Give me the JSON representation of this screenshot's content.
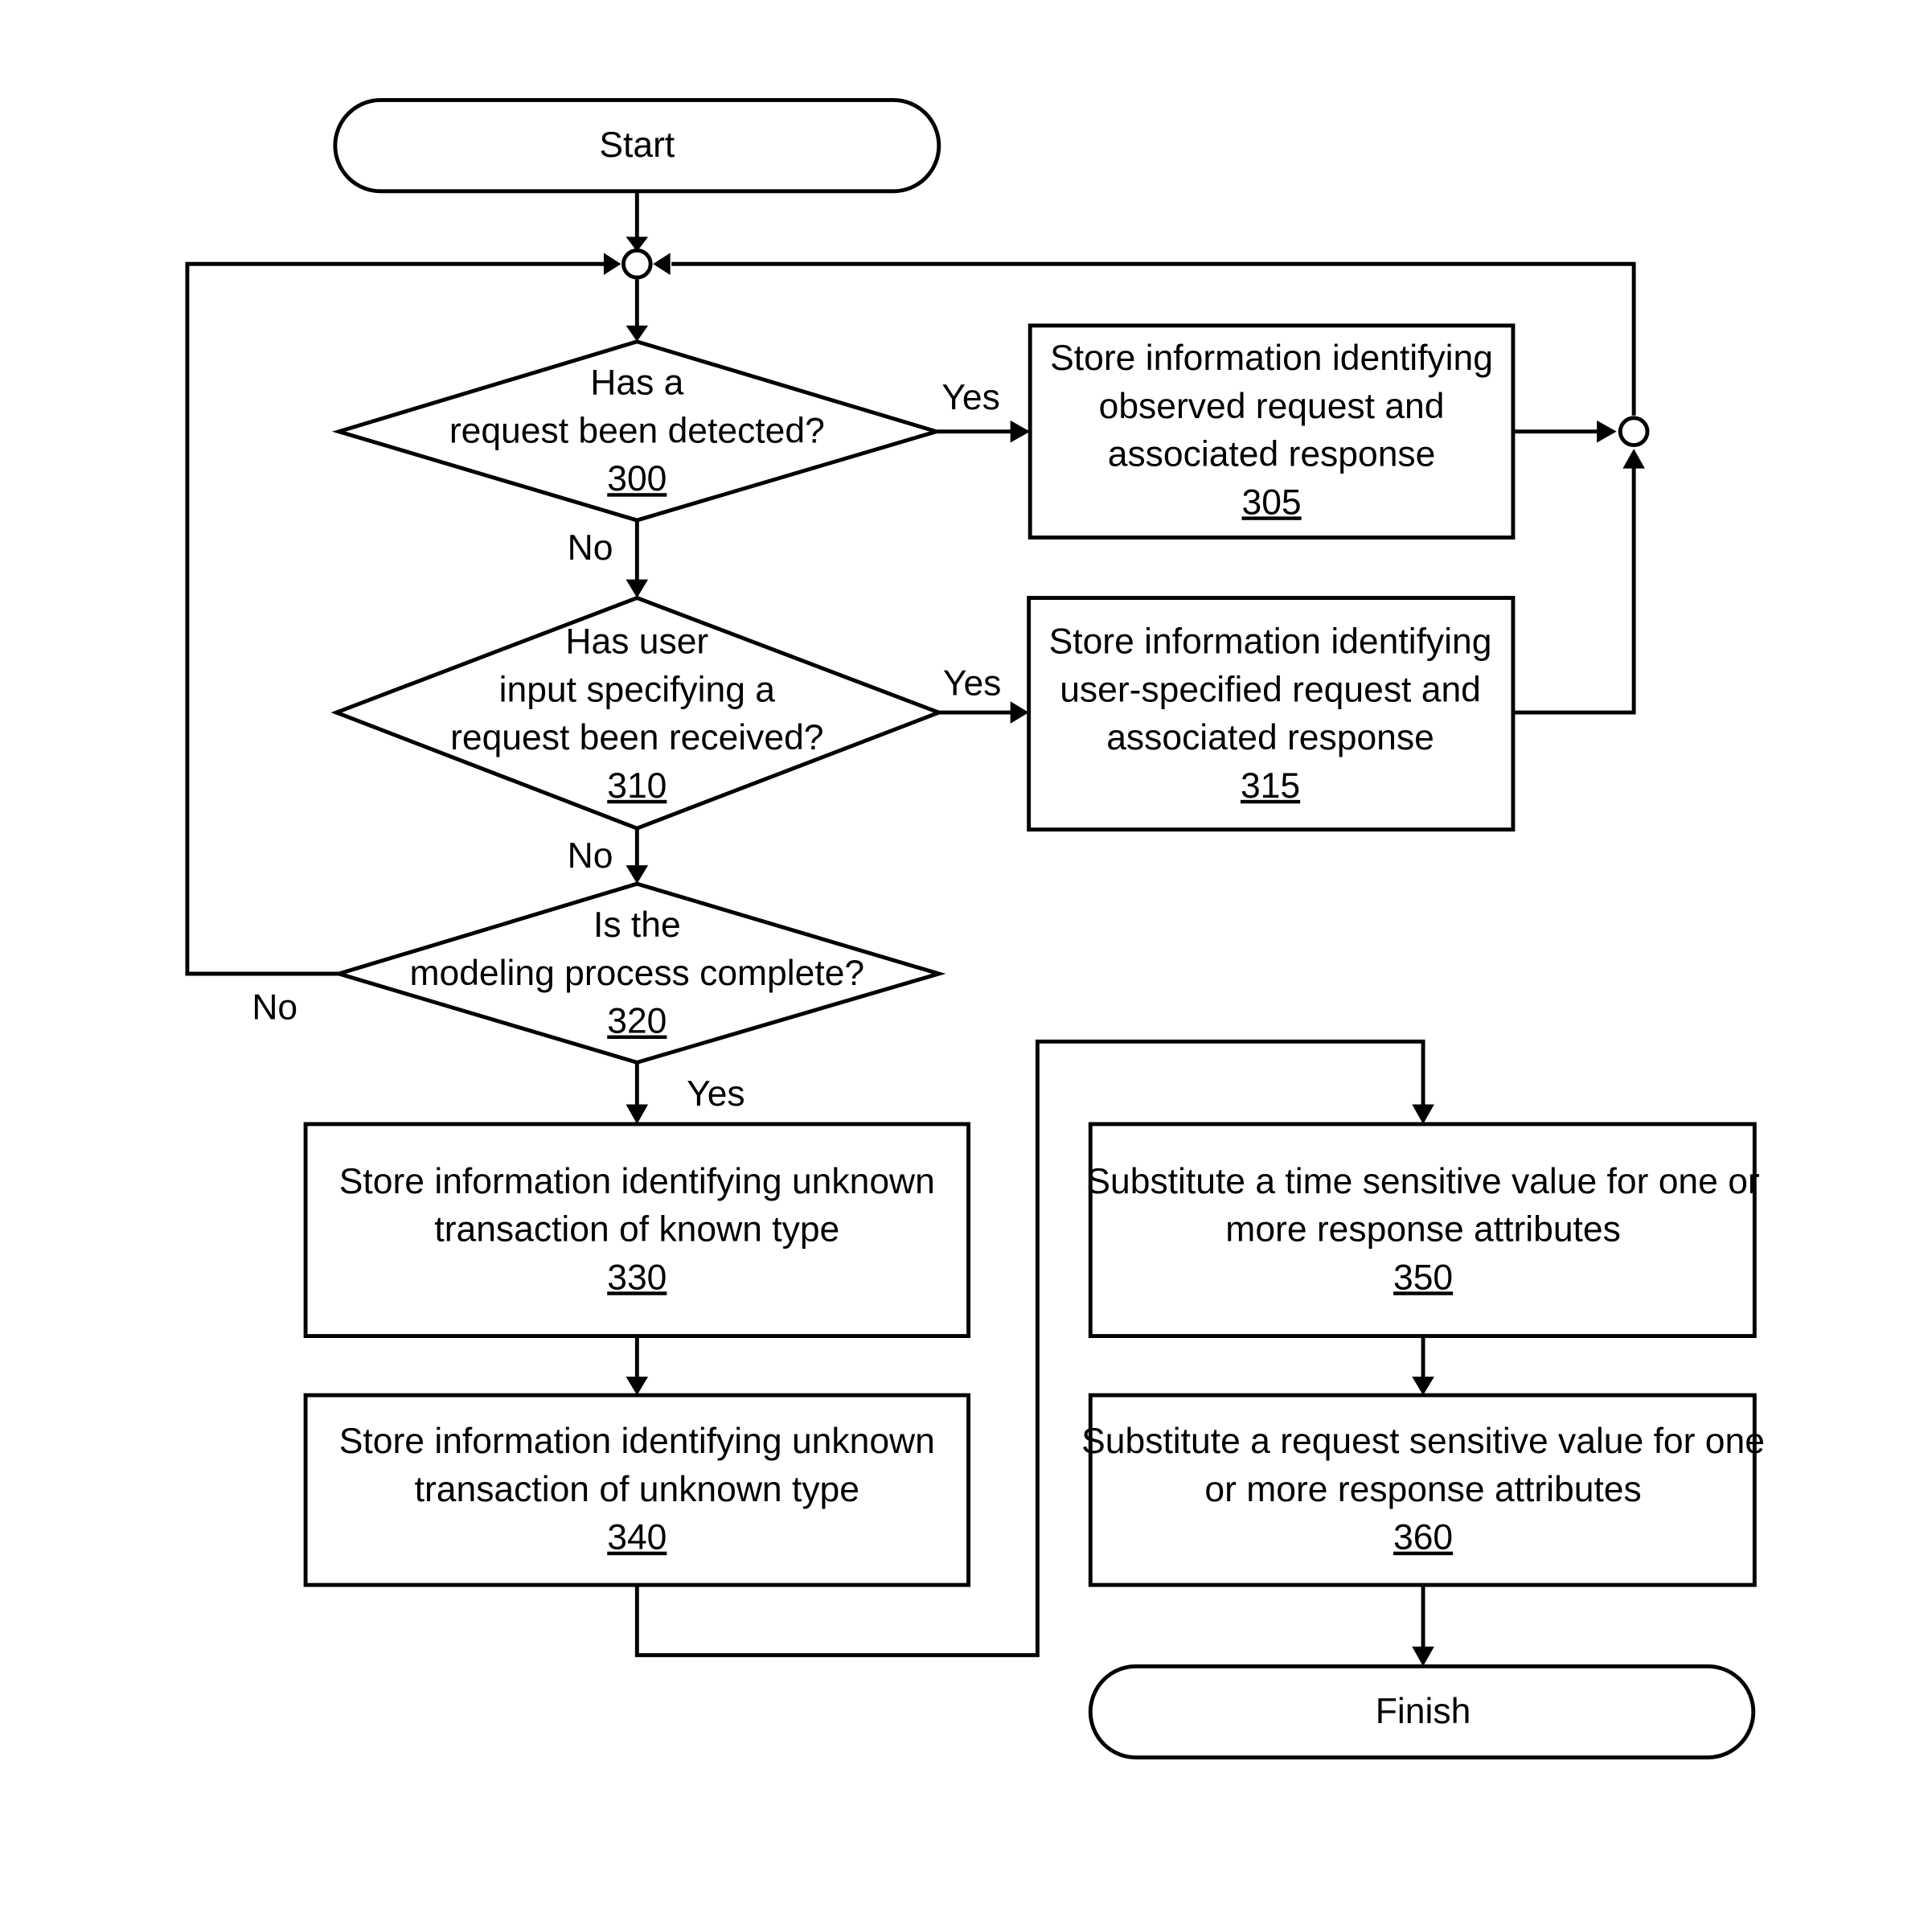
{
  "nodes": {
    "start": {
      "label": "Start"
    },
    "n300": {
      "lines": [
        "Has a",
        "request been detected?"
      ],
      "ref": "300"
    },
    "n305": {
      "lines": [
        "Store information identifying",
        "observed request and",
        "associated response"
      ],
      "ref": "305"
    },
    "n310": {
      "lines": [
        "Has user",
        "input specifying a",
        "request been received?"
      ],
      "ref": "310"
    },
    "n315": {
      "lines": [
        "Store information identifying",
        "user-specified request and",
        "associated response"
      ],
      "ref": "315"
    },
    "n320": {
      "lines": [
        "Is the",
        "modeling process complete?"
      ],
      "ref": "320"
    },
    "n330": {
      "lines": [
        "Store information identifying unknown",
        "transaction of known type"
      ],
      "ref": "330"
    },
    "n340": {
      "lines": [
        "Store information identifying unknown",
        "transaction of unknown type"
      ],
      "ref": "340"
    },
    "n350": {
      "lines": [
        "Substitute a time sensitive value for one or",
        "more response attributes"
      ],
      "ref": "350"
    },
    "n360": {
      "lines": [
        "Substitute a request sensitive value for one",
        "or more response attributes"
      ],
      "ref": "360"
    },
    "finish": {
      "label": "Finish"
    }
  },
  "edge_labels": {
    "e300_yes": "Yes",
    "e300_no": "No",
    "e310_yes": "Yes",
    "e310_no": "No",
    "e320_no": "No",
    "e320_yes": "Yes"
  }
}
